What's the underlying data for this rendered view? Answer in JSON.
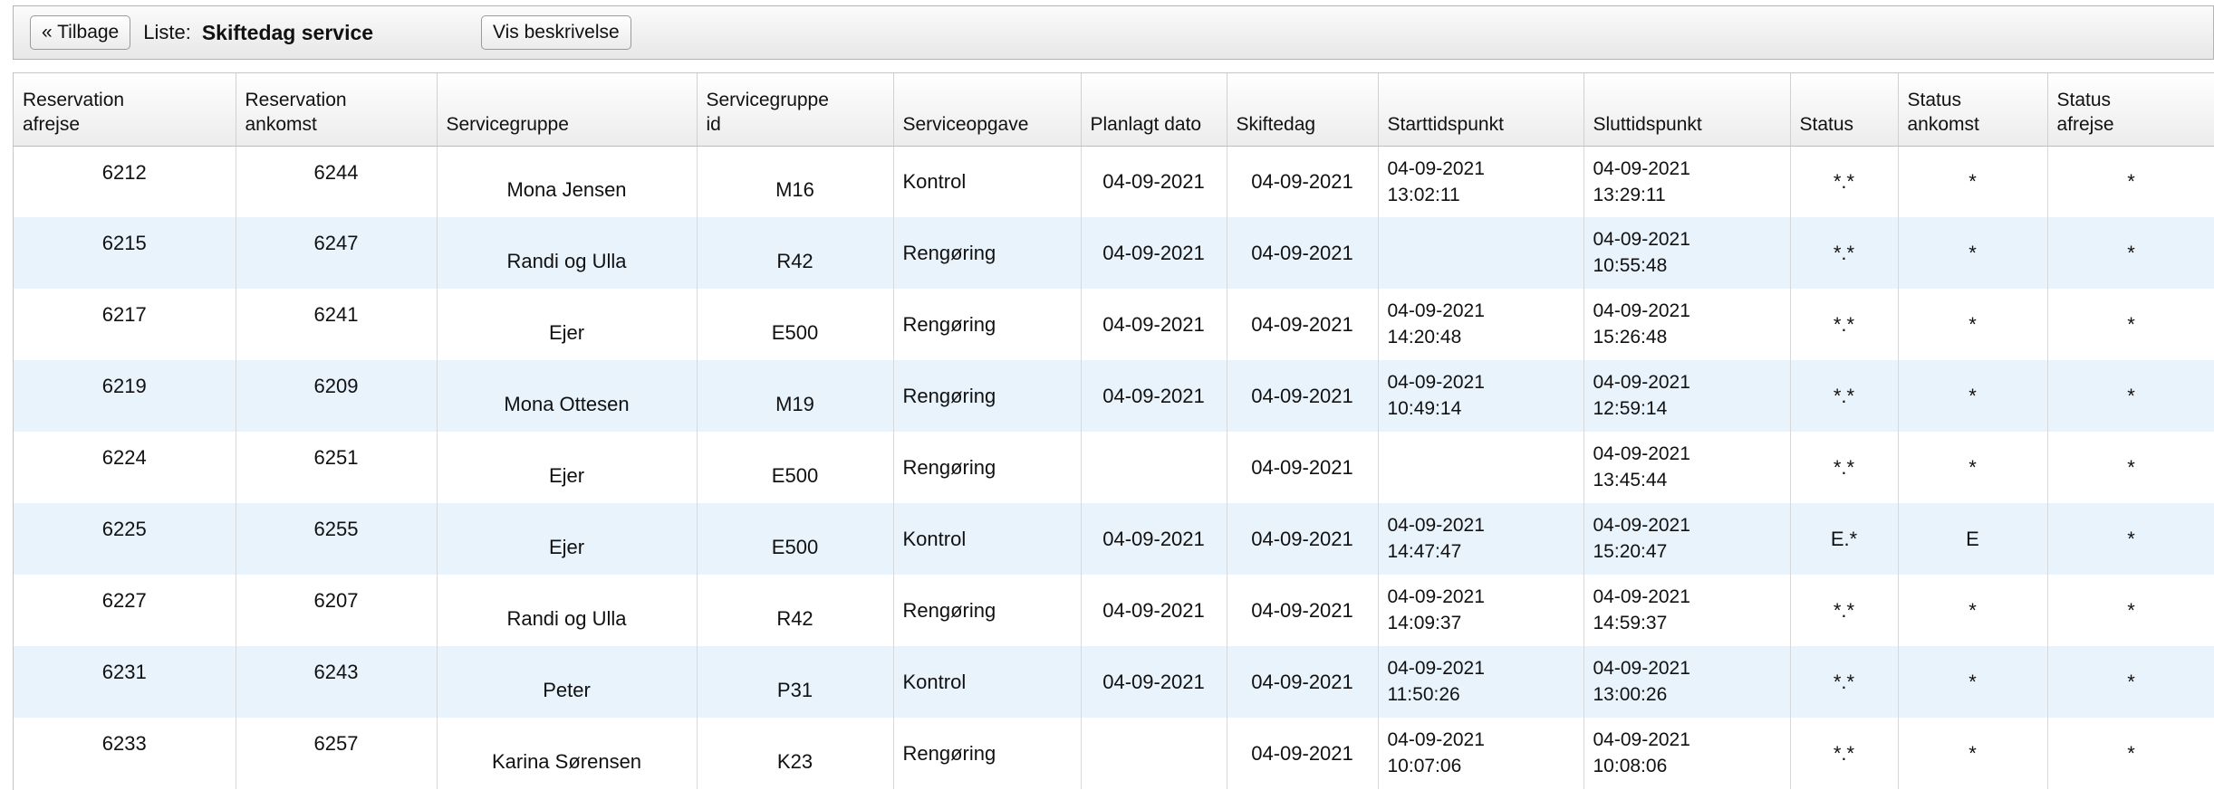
{
  "toolbar": {
    "back_label": "« Tilbage",
    "list_label": "Liste:",
    "list_name": "Skiftedag service",
    "description_label": "Vis beskrivelse"
  },
  "table": {
    "columns": [
      "Reservation\nafrejse",
      "Reservation\nankomst",
      "Servicegruppe",
      "Servicegruppe\nid",
      "Serviceopgave",
      "Planlagt dato",
      "Skiftedag",
      "Starttidspunkt",
      "Sluttidspunkt",
      "Status",
      "Status\nankomst",
      "Status\nafrejse"
    ],
    "rows": [
      {
        "afrejse": "6212",
        "ankomst": "6244",
        "gruppe": "Mona Jensen",
        "gruppe_id": "M16",
        "opgave": "Kontrol",
        "planlagt": "04-09-2021",
        "skiftedag": "04-09-2021",
        "start": "04-09-2021\n13:02:11",
        "slut": "04-09-2021\n13:29:11",
        "status": "*.*",
        "status_ankomst": "*",
        "status_afrejse": "*"
      },
      {
        "afrejse": "6215",
        "ankomst": "6247",
        "gruppe": "Randi og Ulla",
        "gruppe_id": "R42",
        "opgave": "Rengøring",
        "planlagt": "04-09-2021",
        "skiftedag": "04-09-2021",
        "start": "",
        "slut": "04-09-2021\n10:55:48",
        "status": "*.*",
        "status_ankomst": "*",
        "status_afrejse": "*"
      },
      {
        "afrejse": "6217",
        "ankomst": "6241",
        "gruppe": "Ejer",
        "gruppe_id": "E500",
        "opgave": "Rengøring",
        "planlagt": "04-09-2021",
        "skiftedag": "04-09-2021",
        "start": "04-09-2021\n14:20:48",
        "slut": "04-09-2021\n15:26:48",
        "status": "*.*",
        "status_ankomst": "*",
        "status_afrejse": "*"
      },
      {
        "afrejse": "6219",
        "ankomst": "6209",
        "gruppe": "Mona Ottesen",
        "gruppe_id": "M19",
        "opgave": "Rengøring",
        "planlagt": "04-09-2021",
        "skiftedag": "04-09-2021",
        "start": "04-09-2021\n10:49:14",
        "slut": "04-09-2021\n12:59:14",
        "status": "*.*",
        "status_ankomst": "*",
        "status_afrejse": "*"
      },
      {
        "afrejse": "6224",
        "ankomst": "6251",
        "gruppe": "Ejer",
        "gruppe_id": "E500",
        "opgave": "Rengøring",
        "planlagt": "",
        "skiftedag": "04-09-2021",
        "start": "",
        "slut": "04-09-2021\n13:45:44",
        "status": "*.*",
        "status_ankomst": "*",
        "status_afrejse": "*"
      },
      {
        "afrejse": "6225",
        "ankomst": "6255",
        "gruppe": "Ejer",
        "gruppe_id": "E500",
        "opgave": "Kontrol",
        "planlagt": "04-09-2021",
        "skiftedag": "04-09-2021",
        "start": "04-09-2021\n14:47:47",
        "slut": "04-09-2021\n15:20:47",
        "status": "E.*",
        "status_ankomst": "E",
        "status_afrejse": "*"
      },
      {
        "afrejse": "6227",
        "ankomst": "6207",
        "gruppe": "Randi og Ulla",
        "gruppe_id": "R42",
        "opgave": "Rengøring",
        "planlagt": "04-09-2021",
        "skiftedag": "04-09-2021",
        "start": "04-09-2021\n14:09:37",
        "slut": "04-09-2021\n14:59:37",
        "status": "*.*",
        "status_ankomst": "*",
        "status_afrejse": "*"
      },
      {
        "afrejse": "6231",
        "ankomst": "6243",
        "gruppe": "Peter",
        "gruppe_id": "P31",
        "opgave": "Kontrol",
        "planlagt": "04-09-2021",
        "skiftedag": "04-09-2021",
        "start": "04-09-2021\n11:50:26",
        "slut": "04-09-2021\n13:00:26",
        "status": "*.*",
        "status_ankomst": "*",
        "status_afrejse": "*"
      },
      {
        "afrejse": "6233",
        "ankomst": "6257",
        "gruppe": "Karina Sørensen",
        "gruppe_id": "K23",
        "opgave": "Rengøring",
        "planlagt": "",
        "skiftedag": "04-09-2021",
        "start": "04-09-2021\n10:07:06",
        "slut": "04-09-2021\n10:08:06",
        "status": "*.*",
        "status_ankomst": "*",
        "status_afrejse": "*"
      }
    ]
  }
}
